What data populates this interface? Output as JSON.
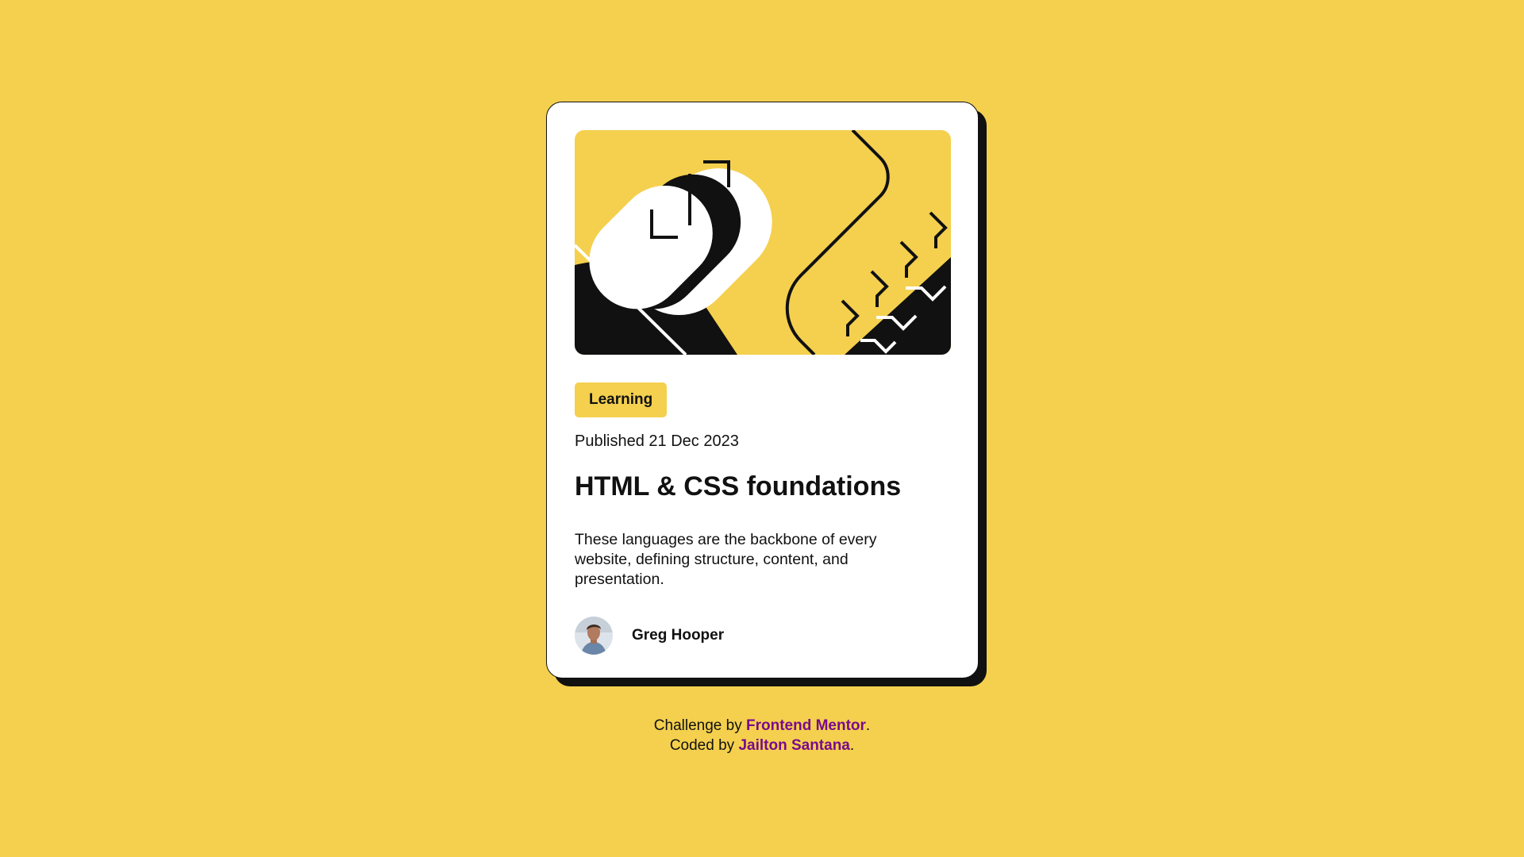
{
  "card": {
    "tag": "Learning",
    "published": "Published 21 Dec 2023",
    "title": "HTML & CSS foundations",
    "description": "These languages are the backbone of every website, defining structure, content, and presentation.",
    "author": "Greg Hooper",
    "illustration_icon": "code-brackets-illustration",
    "avatar_icon": "avatar-icon"
  },
  "attribution": {
    "challenge_prefix": "Challenge by",
    "challenge_link": "Frontend Mentor",
    "coded_prefix": "Coded by",
    "coded_link": "Jailton Santana",
    "period": "."
  },
  "colors": {
    "background": "#F4D04E",
    "card": "#FFFFFF",
    "ink": "#111111",
    "link": "#7A0A8C"
  }
}
